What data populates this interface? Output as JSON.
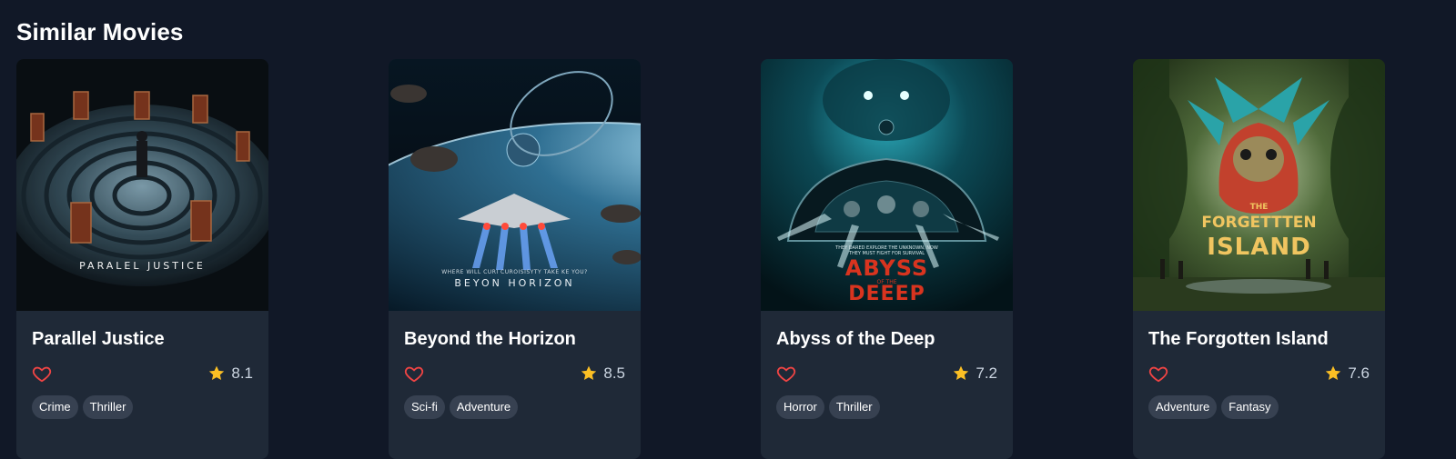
{
  "section": {
    "title": "Similar Movies"
  },
  "movies": [
    {
      "title": "Parallel Justice",
      "rating": "8.1",
      "genres": [
        "Crime",
        "Thriller"
      ],
      "poster_text": [
        "PARALEL JUSTICE"
      ]
    },
    {
      "title": "Beyond the Horizon",
      "rating": "8.5",
      "genres": [
        "Sci-fi",
        "Adventure"
      ],
      "poster_text": [
        "WHERE WILL CURI CUROISISYTY TAKE KE YOU?",
        "BEYON HORIZON"
      ]
    },
    {
      "title": "Abyss of the Deep",
      "rating": "7.2",
      "genres": [
        "Horror",
        "Thriller"
      ],
      "poster_text": [
        "THEY DARED EXPLORE THE UNKNOWN, NOW THEY MUST FIGHT FOR SURVIVAL",
        "ABYSS",
        "OF THE",
        "DEEEP"
      ]
    },
    {
      "title": "The Forgotten Island",
      "rating": "7.6",
      "genres": [
        "Adventure",
        "Fantasy"
      ],
      "poster_text": [
        "THE",
        "FORGETTTEN",
        "ISLAND"
      ]
    }
  ],
  "icons": {
    "favorite": "heart-outline-icon",
    "rating": "star-icon"
  },
  "colors": {
    "background": "#111827",
    "card": "#1f2937",
    "chip": "#374151",
    "heart": "#ef4444",
    "star": "#fbbf24"
  }
}
